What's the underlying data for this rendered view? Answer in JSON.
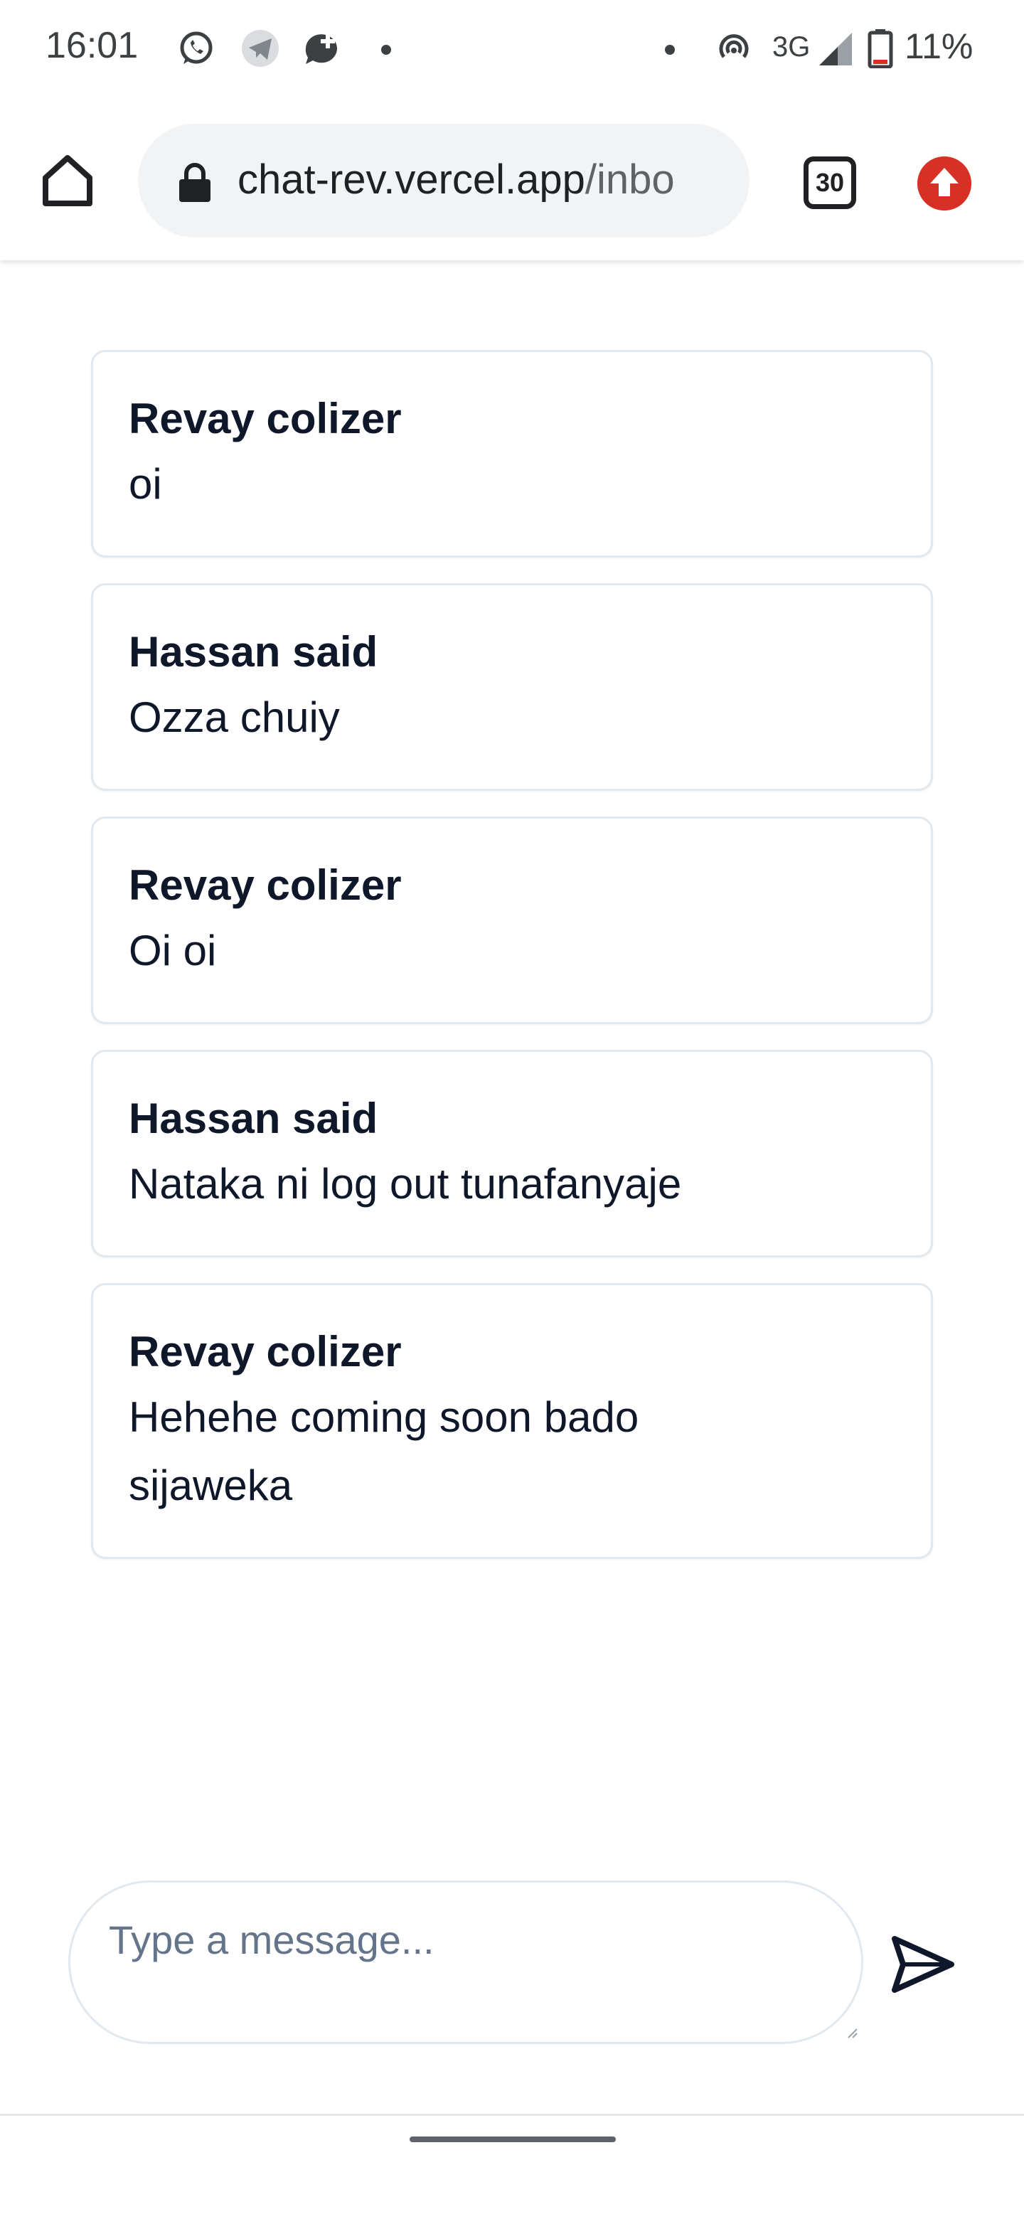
{
  "status_bar": {
    "time": "16:01",
    "network": "3G",
    "battery": "11%",
    "notification_icons": [
      "whatsapp-icon",
      "telegram-icon",
      "chat-plus-icon"
    ],
    "system_icons": [
      "hotspot-icon",
      "signal-icon",
      "battery-icon"
    ]
  },
  "browser": {
    "url_domain": "chat-rev.vercel.app",
    "url_path": "/inbo",
    "tab_count": "30",
    "icons": [
      "home-icon",
      "lock-icon",
      "tab-switcher-icon",
      "update-icon"
    ],
    "update_color": "#d93025"
  },
  "messages": [
    {
      "sender": "Revay colizer",
      "text": "oi"
    },
    {
      "sender": "Hassan said",
      "text": "Ozza chuiy"
    },
    {
      "sender": "Revay colizer",
      "text": "Oi oi"
    },
    {
      "sender": "Hassan said",
      "text": "Nataka ni log out tunafanyaje"
    },
    {
      "sender": "Revay colizer",
      "text": "Hehehe coming soon bado sijaweka"
    }
  ],
  "composer": {
    "placeholder": "Type a message...",
    "value": "",
    "send_icon": "send-icon"
  }
}
